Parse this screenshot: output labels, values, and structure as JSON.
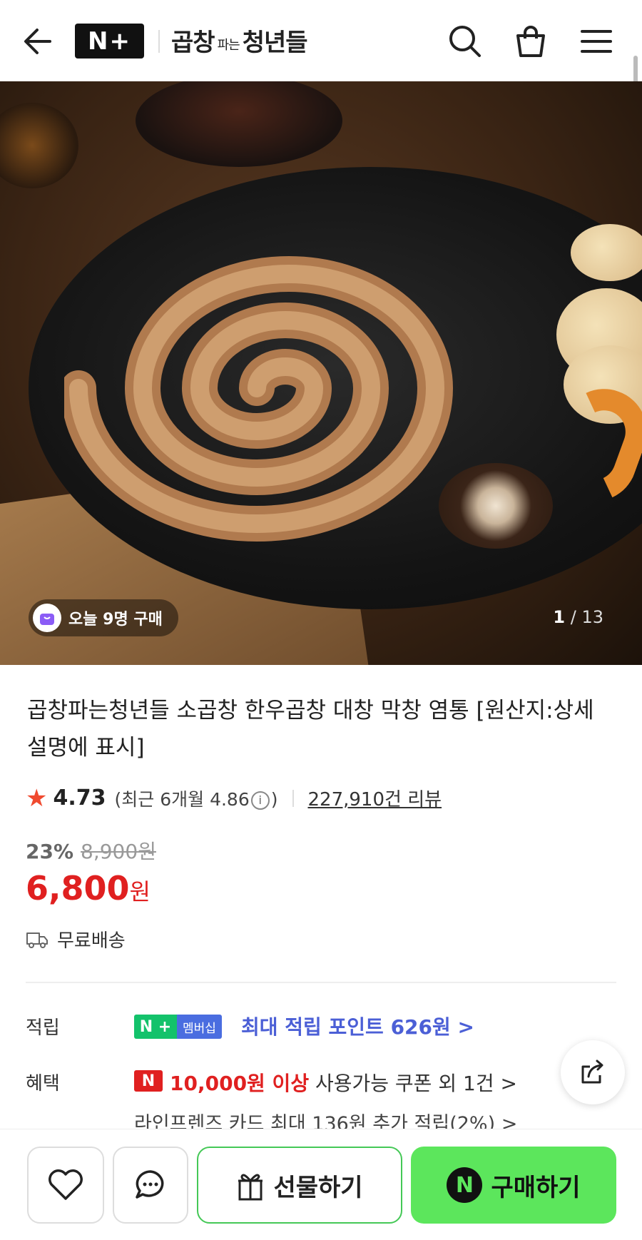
{
  "header": {
    "npay_logo": "N+",
    "store_logo_left": "곱창",
    "store_logo_mid": "파는",
    "store_logo_right": "청년들"
  },
  "hero": {
    "today_badge": "오늘 9명 구매",
    "page_current": "1",
    "page_total": "/ 13"
  },
  "product": {
    "title": "곱창파는청년들 소곱창 한우곱창 대창 막창 염통 [원산지:상세설명에 표시]",
    "rating": "4.73",
    "recent_open": "(최근 6개월 4.86",
    "recent_close": ")",
    "info_icon": "i",
    "review_count": "227,910건 리뷰",
    "discount": "23%",
    "original_price": "8,900원",
    "price": "6,800",
    "price_unit": "원",
    "shipping": "무료배송"
  },
  "benefits": {
    "point_label": "적립",
    "member_badge_n": "N +",
    "member_badge_text": "멤버십",
    "point_text": "최대 적립 포인트 626원 >",
    "benefit_label": "혜택",
    "coupon_badge": "N",
    "coupon_highlight": "10,000원 이상",
    "coupon_rest": " 사용가능 쿠폰 외 1건 >",
    "card_text": "라인프렌즈 카드 최대 136원 추가 적립(2%) >"
  },
  "bottom_bar": {
    "gift_label": "선물하기",
    "buy_label": "구매하기",
    "buy_badge": "N"
  },
  "colors": {
    "price_red": "#e02020",
    "buy_green": "#5ce65c",
    "point_blue": "#4b5fd6"
  }
}
